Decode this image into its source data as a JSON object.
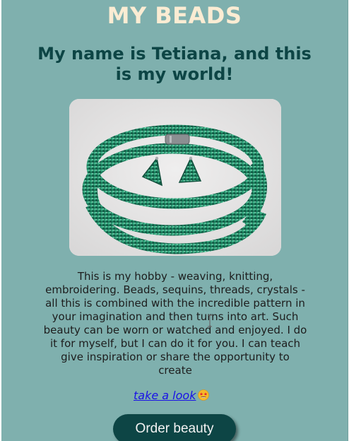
{
  "header": {
    "title": "MY BEADS",
    "subtitle": "My name is Tetiana, and this is my world!"
  },
  "photo": {
    "icon": "beaded-bracelet-and-earrings-photo"
  },
  "description": {
    "text": "This is my hobby - weaving, knitting, embroidering. Beads, sequins, threads, crystals - all this is combined with the incredible pattern in your imagination and then turns into art. Such beauty can be worn or watched and enjoyed. I do it for myself, but I can do it for you. I can teach give inspiration or share the opportunity to create"
  },
  "link": {
    "label": "take a look",
    "emoji_icon": "star-struck-emoji"
  },
  "cta": {
    "label": "Order beauty"
  },
  "colors": {
    "background": "#7fb0ae",
    "title": "#fbecd3",
    "subtitle": "#0d4545",
    "button": "#0d4545",
    "link": "#1a12e6"
  }
}
